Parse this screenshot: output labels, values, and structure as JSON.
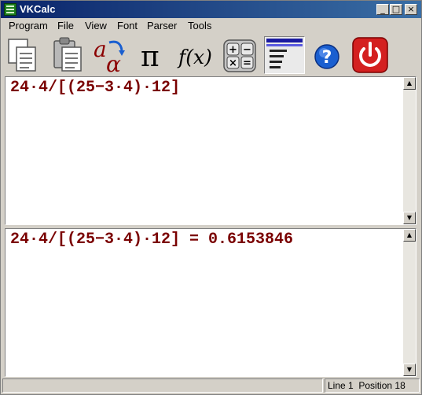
{
  "window": {
    "title": "VKCalc",
    "minimize_glyph": "_",
    "maximize_glyph": "□",
    "close_glyph": "×"
  },
  "menu": {
    "items": [
      "Program",
      "File",
      "View",
      "Font",
      "Parser",
      "Tools"
    ]
  },
  "toolbar": {
    "buttons": [
      {
        "icon": "copy-icon"
      },
      {
        "icon": "paste-icon"
      },
      {
        "icon": "greek-letters-icon",
        "glyph_latin": "a",
        "glyph_greek": "α"
      },
      {
        "icon": "pi-icon",
        "glyph": "π"
      },
      {
        "icon": "function-icon",
        "glyph": "f(x)"
      },
      {
        "icon": "operators-icon",
        "ops": [
          "+",
          "−",
          "×",
          "="
        ]
      },
      {
        "icon": "format-icon",
        "active": true
      },
      {
        "icon": "help-icon",
        "glyph": "?"
      },
      {
        "icon": "power-icon"
      }
    ]
  },
  "input_pane": {
    "text": "24·4/[(25−3·4)·12]"
  },
  "output_pane": {
    "text": "24·4/[(25−3·4)·12] = 0.6153846"
  },
  "scroll": {
    "up_glyph": "▲",
    "down_glyph": "▼"
  },
  "status": {
    "line": "Line 1",
    "position": "Position 18"
  },
  "colors": {
    "expression_text": "#7a0000",
    "title_bar": "#0a246a",
    "power_red": "#d42020",
    "help_blue": "#1a5fd0"
  }
}
